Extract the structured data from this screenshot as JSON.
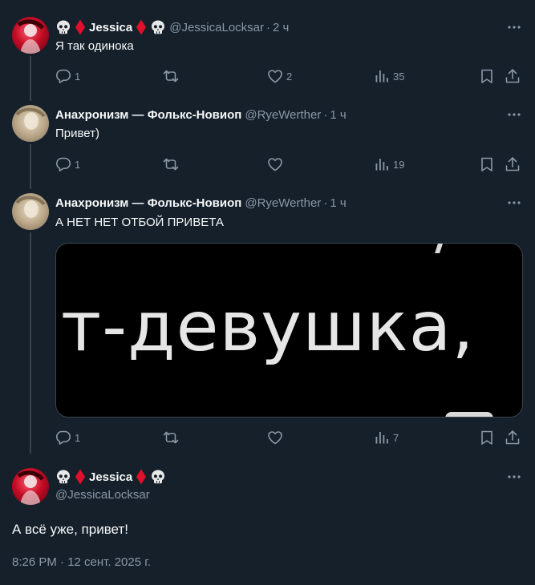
{
  "tweets": [
    {
      "name": "Jessica",
      "handle": "@JessicaLocksar",
      "time": "2 ч",
      "text": "Я так одинока",
      "replies": "1",
      "retweets": "",
      "likes": "2",
      "views": "35"
    },
    {
      "name": "Анахронизм — Фолькс-Новиоп",
      "handle": "@RyeWerther",
      "time": "1 ч",
      "text": "Привет)",
      "replies": "1",
      "retweets": "",
      "likes": "",
      "views": "19"
    },
    {
      "name": "Анахронизм — Фолькс-Новиоп",
      "handle": "@RyeWerther",
      "time": "1 ч",
      "text": "А НЕТ НЕТ ОТБОЙ ПРИВЕТА",
      "media_text": "т-девушка,",
      "replies": "1",
      "retweets": "",
      "likes": "",
      "views": "7"
    }
  ],
  "main_tweet": {
    "name": "Jessica",
    "handle": "@JessicaLocksar",
    "text": "А всё уже, привет!",
    "meta": "8:26 PM · 12 сент. 2025 г."
  },
  "colors": {
    "background": "#15202b",
    "text_primary": "#f7f9f9",
    "text_secondary": "#8b98a5",
    "border": "#38444d",
    "diamond": "#e0102a"
  },
  "icons": [
    "skull-icon",
    "diamond-icon",
    "more-icon",
    "reply-icon",
    "retweet-icon",
    "like-icon",
    "views-icon",
    "bookmark-icon",
    "share-icon"
  ]
}
